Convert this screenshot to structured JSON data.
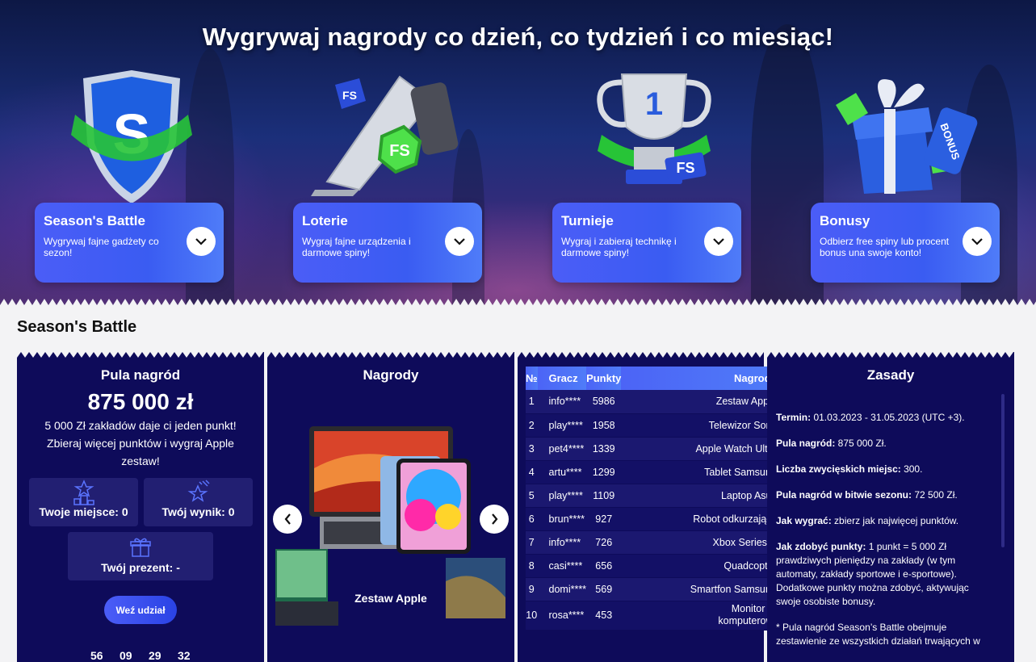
{
  "hero": {
    "title": "Wygrywaj nagrody co dzień, co tydzień i co miesiąc!",
    "cards": [
      {
        "title": "Season's Battle",
        "text": "Wygrywaj fajne gadżety co sezon!"
      },
      {
        "title": "Loterie",
        "text": "Wygraj fajne urządzenia i darmowe spiny!"
      },
      {
        "title": "Turnieje",
        "text": "Wygraj i zabieraj technikę i darmowe spiny!"
      },
      {
        "title": "Bonusy",
        "text": "Odbierz free spiny lub procent bonus una swoje konto!"
      }
    ],
    "badges": {
      "fs": "FS",
      "trophy_rank": "1",
      "bonus": "BONUS",
      "shield": "S"
    }
  },
  "section": {
    "title": "Season's Battle"
  },
  "pool": {
    "title": "Pula nagród",
    "amount": "875 000 zł",
    "desc": "5 000 Zł zakładów daje ci jeden punkt! Zbieraj więcej punktów i wygraj Apple zestaw!",
    "place_label": "Twoje miejsce: 0",
    "score_label": "Twój wynik: 0",
    "gift_label": "Twój prezent: -",
    "join_label": "Weź udział",
    "timer": [
      "56",
      "09",
      "29",
      "32"
    ]
  },
  "prizes": {
    "title": "Nagrody",
    "current": "Zestaw Apple"
  },
  "leaderboard": {
    "headers": [
      "№",
      "Gracz",
      "Punkty",
      "Nagrody"
    ],
    "rows": [
      {
        "n": "1",
        "player": "info****",
        "points": "5986",
        "prize": "Zestaw Apple"
      },
      {
        "n": "2",
        "player": "play****",
        "points": "1958",
        "prize": "Telewizor Sony"
      },
      {
        "n": "3",
        "player": "pet4****",
        "points": "1339",
        "prize": "Apple Watch Ultra"
      },
      {
        "n": "4",
        "player": "artu****",
        "points": "1299",
        "prize": "Tablet Samsung"
      },
      {
        "n": "5",
        "player": "play****",
        "points": "1109",
        "prize": "Laptop Asus"
      },
      {
        "n": "6",
        "player": "brun****",
        "points": "927",
        "prize": "Robot odkurzający"
      },
      {
        "n": "7",
        "player": "info****",
        "points": "726",
        "prize": "Xbox Series X"
      },
      {
        "n": "8",
        "player": "casi****",
        "points": "656",
        "prize": "Quadcopter"
      },
      {
        "n": "9",
        "player": "domi****",
        "points": "569",
        "prize": "Smartfon Samsung"
      },
      {
        "n": "10",
        "player": "rosa****",
        "points": "453",
        "prize": "Monitor komputerowy"
      }
    ]
  },
  "rules": {
    "title": "Zasady",
    "items": [
      {
        "label": "Termin:",
        "text": " 01.03.2023 - 31.05.2023 (UTC +3)."
      },
      {
        "label": "Pula nagród:",
        "text": " 875 000 Zł."
      },
      {
        "label": "Liczba zwycięskich miejsc:",
        "text": " 300."
      },
      {
        "label": "Pula nagród w bitwie sezonu:",
        "text": " 72 500 Zł."
      },
      {
        "label": "Jak wygrać:",
        "text": " zbierz jak najwięcej punktów."
      },
      {
        "label": "Jak zdobyć punkty:",
        "text": " 1 punkt = 5 000 Zł prawdziwych pieniędzy na zakłady (w tym automaty, zakłady sportowe i e-sportowe). Dodatkowe punkty można zdobyć, aktywując swoje osobiste bonusy."
      },
      {
        "label": "",
        "text": "* Pula nagród Season’s Battle obejmuje zestawienie ze wszystkich działań trwających w"
      }
    ]
  },
  "colors": {
    "panel": "#0e0b5a",
    "accent": "#4b5df7",
    "card": "#3a5cf2"
  }
}
